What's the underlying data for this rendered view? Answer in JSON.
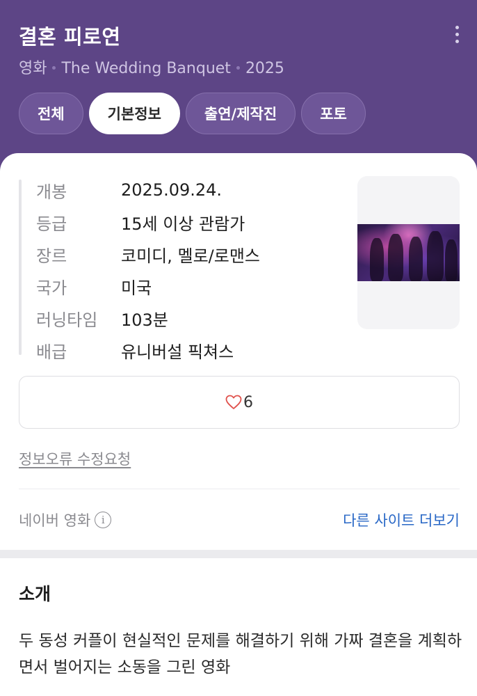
{
  "header": {
    "title": "결혼 피로연",
    "category": "영화",
    "original_title": "The Wedding Banquet",
    "year": "2025",
    "more_icon": "more-vertical-icon"
  },
  "tabs": [
    {
      "label": "전체",
      "active": false
    },
    {
      "label": "기본정보",
      "active": true
    },
    {
      "label": "출연/제작진",
      "active": false
    },
    {
      "label": "포토",
      "active": false
    }
  ],
  "info": [
    {
      "label": "개봉",
      "value": "2025.09.24."
    },
    {
      "label": "등급",
      "value": "15세 이상 관람가"
    },
    {
      "label": "장르",
      "value": "코미디, 멜로/로맨스"
    },
    {
      "label": "국가",
      "value": "미국"
    },
    {
      "label": "러닝타임",
      "value": "103분"
    },
    {
      "label": "배급",
      "value": "유니버설 픽쳐스"
    }
  ],
  "like": {
    "icon": "heart-outline-icon",
    "count": "6",
    "color": "#e0504b"
  },
  "report_link": "정보오류 수정요청",
  "source": {
    "label": "네이버 영화",
    "icon": "info-circle-icon"
  },
  "more_sites": "다른 사이트 더보기",
  "intro": {
    "title": "소개",
    "text": "두 동성 커플이 현실적인 문제를 해결하기 위해 가짜 결혼을 계획하면서 벌어지는 소동을 그린 영화"
  },
  "colors": {
    "header_bg": "#5d4586",
    "link": "#2867c6"
  }
}
